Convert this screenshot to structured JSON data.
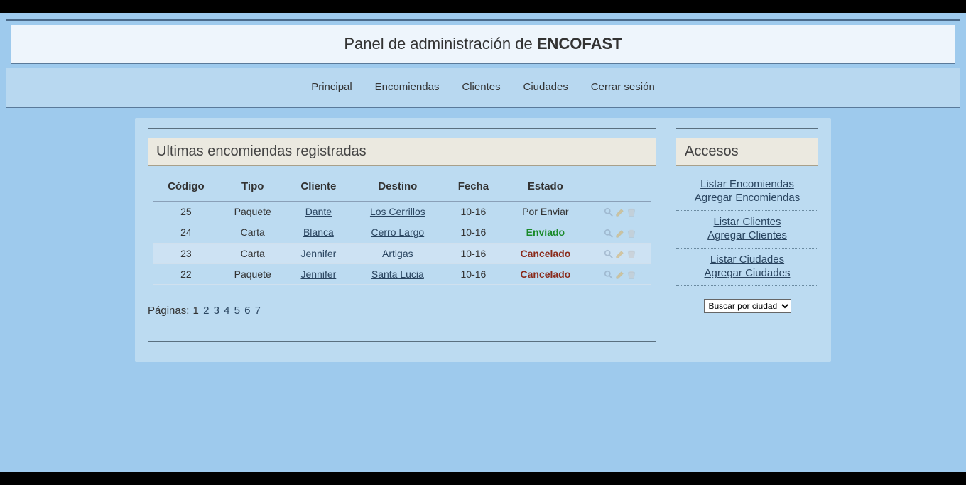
{
  "header": {
    "title_pre": "Panel de administración de ",
    "title_strong": "ENCOFAST"
  },
  "nav": {
    "principal": "Principal",
    "encomiendas": "Encomiendas",
    "clientes": "Clientes",
    "ciudades": "Ciudades",
    "cerrar": "Cerrar sesión"
  },
  "main": {
    "heading": "Ultimas encomiendas registradas",
    "columns": {
      "codigo": "Código",
      "tipo": "Tipo",
      "cliente": "Cliente",
      "destino": "Destino",
      "fecha": "Fecha",
      "estado": "Estado"
    },
    "rows": [
      {
        "codigo": "25",
        "tipo": "Paquete",
        "cliente": "Dante",
        "destino": "Los Cerrillos",
        "fecha": "10-16",
        "estado": "Por Enviar",
        "estado_class": ""
      },
      {
        "codigo": "24",
        "tipo": "Carta",
        "cliente": "Blanca",
        "destino": "Cerro Largo",
        "fecha": "10-16",
        "estado": "Enviado",
        "estado_class": "st-env"
      },
      {
        "codigo": "23",
        "tipo": "Carta",
        "cliente": "Jennifer",
        "destino": "Artigas",
        "fecha": "10-16",
        "estado": "Cancelado",
        "estado_class": "st-can"
      },
      {
        "codigo": "22",
        "tipo": "Paquete",
        "cliente": "Jennifer",
        "destino": "Santa Lucia",
        "fecha": "10-16",
        "estado": "Cancelado",
        "estado_class": "st-can"
      }
    ],
    "pager_label": "Páginas: ",
    "pager_current": "1",
    "pager_pages": [
      "2",
      "3",
      "4",
      "5",
      "6",
      "7"
    ]
  },
  "sidebar": {
    "heading": "Accesos",
    "groups": [
      {
        "links": [
          "Listar Encomiendas",
          "Agregar Encomiendas"
        ]
      },
      {
        "links": [
          "Listar Clientes",
          "Agregar Clientes"
        ]
      },
      {
        "links": [
          "Listar Ciudades",
          "Agregar Ciudades"
        ]
      }
    ],
    "select_label": "Buscar por ciudad"
  }
}
